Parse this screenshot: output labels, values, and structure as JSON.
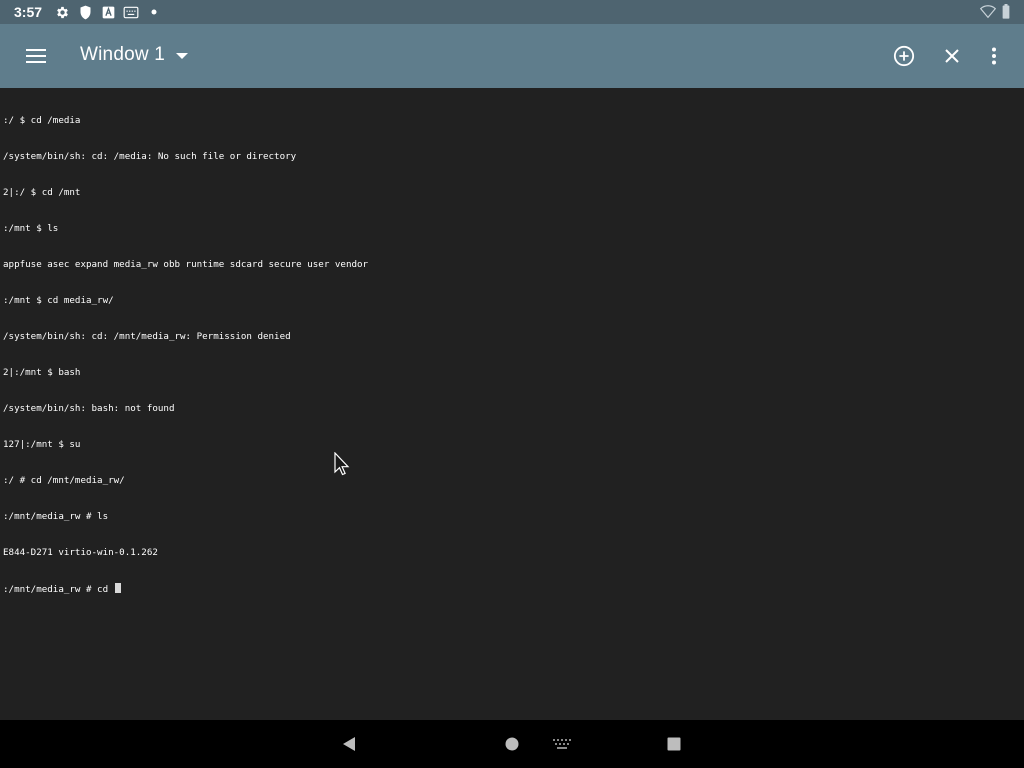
{
  "status_bar": {
    "time": "3:57",
    "icons": [
      "settings-gear-icon",
      "shield-icon",
      "a-letter-icon",
      "keyboard-icon",
      "dot-icon"
    ],
    "right_icons": [
      "wifi-icon",
      "battery-icon"
    ]
  },
  "toolbar": {
    "window_title": "Window 1",
    "icons": [
      "menu-icon",
      "dropdown-icon",
      "add-circle-icon",
      "close-icon",
      "more-vert-icon"
    ]
  },
  "terminal": {
    "lines": [
      ":/ $ cd /media",
      "/system/bin/sh: cd: /media: No such file or directory",
      "2|:/ $ cd /mnt",
      ":/mnt $ ls",
      "appfuse asec expand media_rw obb runtime sdcard secure user vendor",
      ":/mnt $ cd media_rw/",
      "/system/bin/sh: cd: /mnt/media_rw: Permission denied",
      "2|:/mnt $ bash",
      "/system/bin/sh: bash: not found",
      "127|:/mnt $ su",
      ":/ # cd /mnt/media_rw/",
      ":/mnt/media_rw # ls",
      "E844-D271 virtio-win-0.1.262"
    ],
    "prompt_line": ":/mnt/media_rw # cd "
  },
  "nav_bar": {
    "icons": [
      "back-icon",
      "home-icon",
      "keyboard-icon",
      "recents-icon"
    ]
  },
  "colors": {
    "status_bar": "#4e6470",
    "toolbar": "#5f7d8c",
    "terminal_bg": "#212121",
    "terminal_text": "#ffffff",
    "nav_bar": "#000000"
  }
}
